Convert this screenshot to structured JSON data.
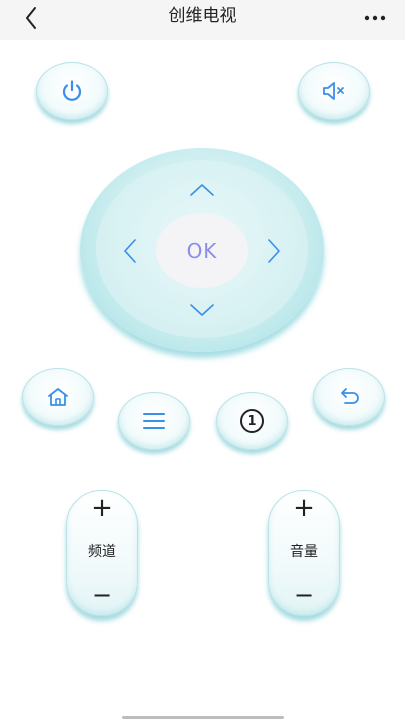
{
  "header": {
    "title": "创维电视",
    "back_icon": "chevron-left-icon",
    "more_icon": "more-dots-icon"
  },
  "remote": {
    "power_icon": "power-icon",
    "mute_icon": "mute-icon",
    "ok_label": "OK",
    "home_icon": "home-icon",
    "menu_icon": "menu-icon",
    "number_label": "1",
    "return_icon": "return-icon",
    "channel": {
      "label": "频道",
      "plus": "+",
      "minus": "−"
    },
    "volume": {
      "label": "音量",
      "plus": "+",
      "minus": "−"
    }
  },
  "colors": {
    "accent_blue": "#3a8fe8",
    "ok_text": "#8b8ee8",
    "button_shadow": "#5fbec8",
    "dpad_ring": "#9ddde2"
  }
}
